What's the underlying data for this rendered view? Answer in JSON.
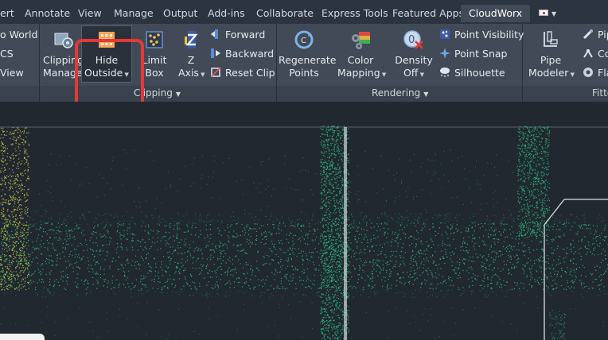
{
  "tabs": [
    {
      "label": "ert",
      "active": false
    },
    {
      "label": "Annotate",
      "active": false
    },
    {
      "label": "View",
      "active": false
    },
    {
      "label": "Manage",
      "active": false
    },
    {
      "label": "Output",
      "active": false
    },
    {
      "label": "Add-ins",
      "active": false
    },
    {
      "label": "Collaborate",
      "active": false
    },
    {
      "label": "Express Tools",
      "active": false
    },
    {
      "label": "Featured Apps",
      "active": false
    },
    {
      "label": "CloudWorx",
      "active": true
    }
  ],
  "ucs_panel": {
    "items": [
      "o World",
      "CS",
      "View"
    ]
  },
  "clipping_panel": {
    "title": "Clipping",
    "clipping_manager": {
      "line1": "Clipping",
      "line2": "Manager"
    },
    "hide_outside": {
      "line1": "Hide",
      "line2": "Outside"
    },
    "limit_box": {
      "line1": "Limit",
      "line2": "Box"
    },
    "z_axis": {
      "line1": "Z",
      "line2": "Axis"
    },
    "forward": "Forward",
    "backward": "Backward",
    "reset_clip": "Reset Clip"
  },
  "rendering_panel": {
    "title": "Rendering",
    "regenerate_points": {
      "line1": "Regenerate",
      "line2": "Points"
    },
    "color_mapping": {
      "line1": "Color",
      "line2": "Mapping"
    },
    "density_off": {
      "line1": "Density",
      "line2": "Off"
    },
    "point_visibility": "Point Visibility",
    "point_snap": "Point Snap",
    "silhouette": "Silhouette"
  },
  "fitting_panel": {
    "title": "Fitte",
    "pipe_modeler": {
      "line1": "Pipe",
      "line2": "Modeler"
    },
    "items": [
      "Pip",
      "Co",
      "Fla"
    ]
  },
  "colors": {
    "ribbon": "#414a56",
    "viewport": "#212830",
    "highlight": "#e53935",
    "points_green": "#2fd48a",
    "points_yellow": "#d8d84a"
  }
}
